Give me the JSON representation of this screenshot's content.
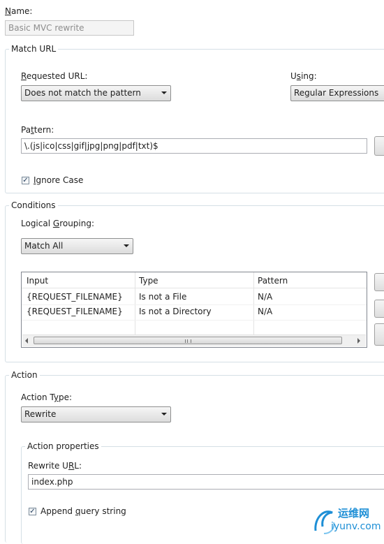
{
  "name": {
    "label": "Name:",
    "value": "Basic MVC rewrite"
  },
  "match_url": {
    "title": "Match URL",
    "requested_url_label": "Requested URL:",
    "requested_url_value": "Does not match the pattern",
    "using_label": "Using:",
    "using_value": "Regular Expressions",
    "pattern_label": "Pattern:",
    "pattern_value": "\\.(js|ico|css|gif|jpg|png|pdf|txt)$",
    "ignore_case_label": "Ignore Case",
    "ignore_case_checked": true
  },
  "conditions": {
    "title": "Conditions",
    "logical_grouping_label": "Logical Grouping:",
    "logical_grouping_value": "Match All",
    "columns": [
      "Input",
      "Type",
      "Pattern"
    ],
    "rows": [
      [
        "{REQUEST_FILENAME}",
        "Is not a File",
        "N/A"
      ],
      [
        "{REQUEST_FILENAME}",
        "Is not a Directory",
        "N/A"
      ]
    ]
  },
  "action": {
    "title": "Action",
    "action_type_label": "Action Type:",
    "action_type_value": "Rewrite",
    "properties_title": "Action properties",
    "rewrite_url_label": "Rewrite URL:",
    "rewrite_url_value": "index.php",
    "append_query_label": "Append query string",
    "append_query_checked": true
  },
  "watermark": {
    "text_cn": "运维网",
    "text_url": "iyunv.com"
  }
}
